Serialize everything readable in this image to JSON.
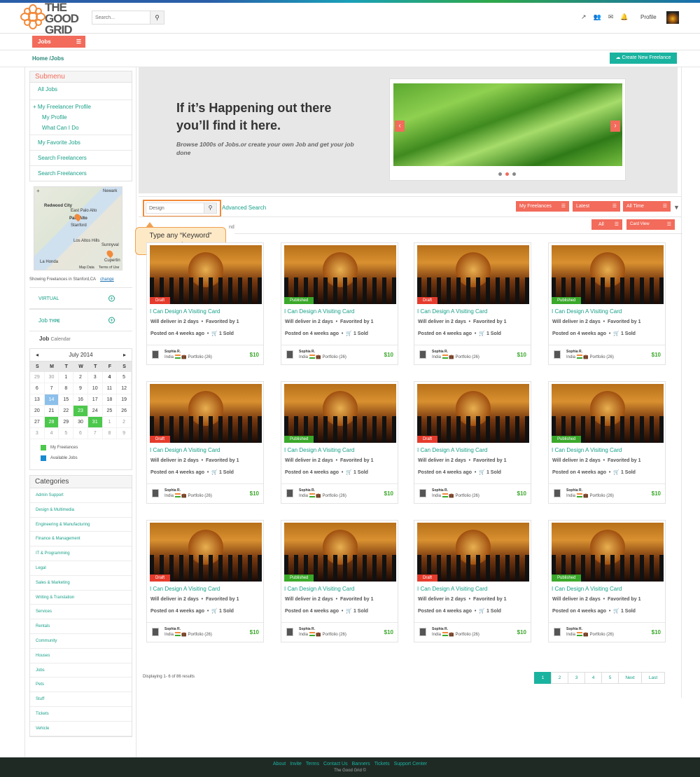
{
  "header": {
    "logo_text": "THE GOOD GRID",
    "search_placeholder": "Search...",
    "profile_label": "Profile"
  },
  "jobs_menu": {
    "label": "Jobs"
  },
  "breadcrumb": "Home /Jobs",
  "create_button": "Create New Freelance",
  "submenu": {
    "title": "Submenu",
    "items": [
      "All Jobs",
      "+ My Freelancer Profile",
      "My Profile",
      "What Can I Do",
      "My Favorite Jobs",
      "Search Freelancers",
      "Search Freelancers"
    ]
  },
  "map": {
    "labels": [
      "Redwood City",
      "East Palo Alto",
      "Palo Alto",
      "Stanford",
      "Los Altos Hills",
      "Sunnyval",
      "Cupertin",
      "La Honda",
      "Newark",
      "Map Data",
      "Terms of Use"
    ]
  },
  "showing": {
    "text": "Showing Freelances in Stanford,CA",
    "link": "change"
  },
  "virtual_label": "VIRTUAL",
  "job_type": {
    "a": "Job",
    "b": "TYPE"
  },
  "job_calendar": {
    "a": "Job",
    "b": "Calendar"
  },
  "calendar": {
    "month": "July 2014",
    "dow": [
      "S",
      "M",
      "T",
      "W",
      "T",
      "F",
      "S"
    ],
    "days": [
      [
        "29",
        "o"
      ],
      [
        "30",
        "o"
      ],
      [
        "1",
        ""
      ],
      [
        "2",
        ""
      ],
      [
        "3",
        ""
      ],
      [
        "4",
        "bold"
      ],
      [
        "5",
        ""
      ],
      [
        "6",
        ""
      ],
      [
        "7",
        ""
      ],
      [
        "8",
        ""
      ],
      [
        "9",
        ""
      ],
      [
        "10",
        ""
      ],
      [
        "11",
        ""
      ],
      [
        "12",
        ""
      ],
      [
        "13",
        ""
      ],
      [
        "14",
        "b"
      ],
      [
        "15",
        ""
      ],
      [
        "16",
        ""
      ],
      [
        "17",
        ""
      ],
      [
        "18",
        ""
      ],
      [
        "19",
        ""
      ],
      [
        "20",
        ""
      ],
      [
        "21",
        ""
      ],
      [
        "22",
        ""
      ],
      [
        "23",
        "g"
      ],
      [
        "24",
        ""
      ],
      [
        "25",
        ""
      ],
      [
        "26",
        ""
      ],
      [
        "27",
        ""
      ],
      [
        "28",
        "g"
      ],
      [
        "29",
        ""
      ],
      [
        "30",
        ""
      ],
      [
        "31",
        "g"
      ],
      [
        "1",
        "o"
      ],
      [
        "2",
        "o"
      ],
      [
        "3",
        "o"
      ],
      [
        "4",
        "o"
      ],
      [
        "5",
        "o"
      ],
      [
        "6",
        "o"
      ],
      [
        "7",
        "o"
      ],
      [
        "8",
        "o"
      ],
      [
        "9",
        "o"
      ]
    ],
    "legend": [
      {
        "label": "My Freelances",
        "color": "#4cc84c"
      },
      {
        "label": "Available Jobs",
        "color": "#1a8ad0"
      }
    ]
  },
  "categories": {
    "title": "Categories",
    "items": [
      "Admin Support",
      "Design & Multimedia",
      "Engineering & Manufacturing",
      "Finance & Management",
      "IT & Programming",
      "Legal",
      "Sales & Marketing",
      "Writing & Translation",
      "Services",
      "Rentals",
      "Community",
      "Houses",
      "Jobs",
      "Pets",
      "Stuff",
      "Tickets",
      "Vehicle"
    ]
  },
  "banner": {
    "headline": "If it’s Happening out there you’ll find it here.",
    "sub": "Browse 1000s of Jobs.or create your own Job and get your job done"
  },
  "toolbar": {
    "search_value": "Design",
    "advanced": "Advanced Search",
    "callout": "Type any “Keyword” Search Bar",
    "dd_my": "My Freelances",
    "dd_latest": "Latest",
    "dd_time": "All Time",
    "dd_all": "All",
    "dd_view": "Card View",
    "under_callout": "nd"
  },
  "cards": [
    {
      "status": "Draft"
    },
    {
      "status": "Published"
    },
    {
      "status": "Draft"
    },
    {
      "status": "Published"
    },
    {
      "status": "Draft"
    },
    {
      "status": "Published"
    },
    {
      "status": "Draft"
    },
    {
      "status": "Published"
    },
    {
      "status": "Draft"
    },
    {
      "status": "Published"
    },
    {
      "status": "Draft"
    },
    {
      "status": "Published"
    }
  ],
  "card_common": {
    "title": "I Can Design A Visiting Card",
    "deliver": "Will deliver in 2 days",
    "favorited": "Favorited by 1",
    "posted": "Posted on 4 weeks ago",
    "sold": "1 Sold",
    "seller": "Sophia R.",
    "country": "India",
    "portfolio": "Portfolio (26)",
    "price": "$10"
  },
  "results": "Displaying 1- 6 of 86 results",
  "pagination": [
    "1",
    "2",
    "3",
    "4",
    "5",
    "Next",
    "Last"
  ],
  "footer": {
    "links": [
      "About",
      "Invite",
      "Terms",
      "Contact Us",
      "Banners",
      "Tickets",
      "Support Center"
    ],
    "copy": "The Good Grid ©"
  }
}
